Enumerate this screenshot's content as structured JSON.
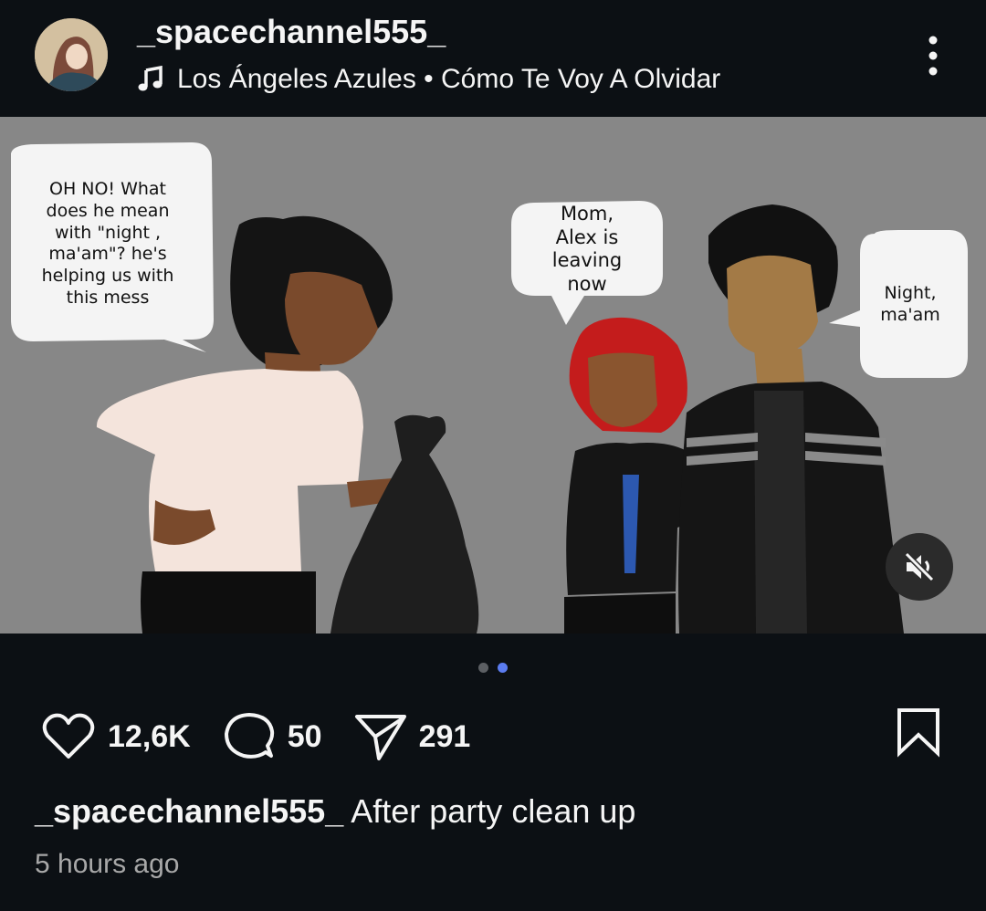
{
  "header": {
    "username": "_spacechannel555_",
    "music": "Los Ángeles Azules • Cómo Te Voy A Olvidar"
  },
  "post": {
    "bubbles": {
      "left_lines": [
        "OH NO! What",
        "does he mean",
        "with \"night ,",
        "ma'am\"? he's",
        "helping us with",
        "this mess"
      ],
      "middle_lines": [
        "Mom,",
        "Alex is",
        "leaving",
        "now"
      ],
      "right_lines": [
        "Night,",
        "ma'am"
      ]
    },
    "carousel": {
      "total": 2,
      "active": 2
    }
  },
  "actions": {
    "likes": "12,6K",
    "comments": "50",
    "shares": "291"
  },
  "caption": {
    "username": "_spacechannel555_",
    "text": "After party clean up"
  },
  "timestamp": "5 hours ago",
  "colors": {
    "background": "#0c1014",
    "panel_gray": "#878787",
    "dot_active": "#5b7cf0",
    "muted_text": "#a8a8a8"
  },
  "icons": [
    "more-vertical-icon",
    "music-note-icon",
    "heart-icon",
    "comment-icon",
    "send-icon",
    "bookmark-icon",
    "speaker-muted-icon"
  ]
}
